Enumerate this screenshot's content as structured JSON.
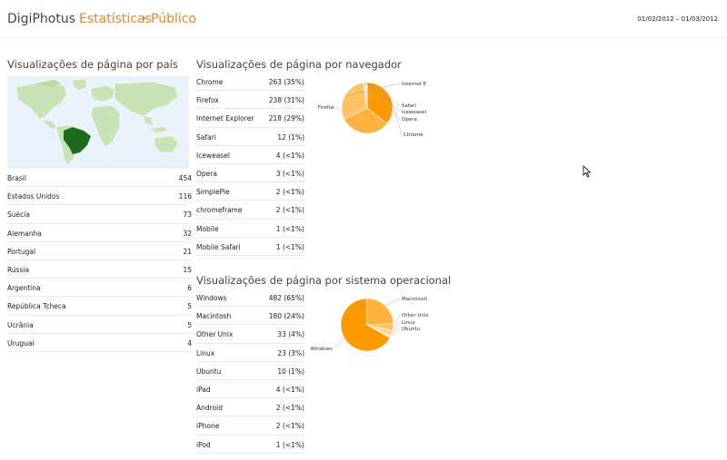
{
  "header": {
    "app_name": "DigiPhotus",
    "separator_dot": "·",
    "crumbs": [
      "Estatísticas",
      "Público"
    ],
    "crumb_separator": "›",
    "date_range": "01/02/2012 – 01/03/2012"
  },
  "country": {
    "title": "Visualizações de página por país",
    "rows": [
      {
        "name": "Brasil",
        "value": "454"
      },
      {
        "name": "Estados Unidos",
        "value": "116"
      },
      {
        "name": "Suécia",
        "value": "73"
      },
      {
        "name": "Alemanha",
        "value": "32"
      },
      {
        "name": "Portugal",
        "value": "21"
      },
      {
        "name": "Rússia",
        "value": "15"
      },
      {
        "name": "Argentina",
        "value": "6"
      },
      {
        "name": "República Tcheca",
        "value": "5"
      },
      {
        "name": "Ucrânia",
        "value": "5"
      },
      {
        "name": "Uruguai",
        "value": "4"
      }
    ]
  },
  "browser": {
    "title": "Visualizações de página por navegador",
    "rows": [
      {
        "name": "Chrome",
        "value": "263 (35%)"
      },
      {
        "name": "Firefox",
        "value": "238 (31%)"
      },
      {
        "name": "Internet Explorer",
        "value": "218 (29%)"
      },
      {
        "name": "Safari",
        "value": "12 (1%)"
      },
      {
        "name": "Iceweasel",
        "value": "4 (<1%)"
      },
      {
        "name": "Opera",
        "value": "3 (<1%)"
      },
      {
        "name": "SimplePie",
        "value": "2 (<1%)"
      },
      {
        "name": "chromeframe",
        "value": "2 (<1%)"
      },
      {
        "name": "Mobile",
        "value": "1 (<1%)"
      },
      {
        "name": "Mobile Safari",
        "value": "1 (<1%)"
      }
    ]
  },
  "os": {
    "title": "Visualizações de página por sistema operacional",
    "rows": [
      {
        "name": "Windows",
        "value": "482 (65%)"
      },
      {
        "name": "Macintosh",
        "value": "180 (24%)"
      },
      {
        "name": "Other Unix",
        "value": "33 (4%)"
      },
      {
        "name": "Linux",
        "value": "23 (3%)"
      },
      {
        "name": "Ubuntu",
        "value": "10 (1%)"
      },
      {
        "name": "iPad",
        "value": "4 (<1%)"
      },
      {
        "name": "Android",
        "value": "2 (<1%)"
      },
      {
        "name": "iPhone",
        "value": "2 (<1%)"
      },
      {
        "name": "iPod",
        "value": "1 (<1%)"
      }
    ]
  },
  "chart_data": [
    {
      "type": "pie",
      "labels": [
        "Chrome",
        "Firefox",
        "Internet E",
        "Safari",
        "Iceweasel",
        "Opera"
      ],
      "values": [
        263,
        238,
        218,
        12,
        4,
        3
      ],
      "colors": [
        "#ff9900",
        "#ffb33d",
        "#ffc266",
        "#ffd699",
        "#ffe0b3",
        "#ffeacc"
      ]
    },
    {
      "type": "pie",
      "labels": [
        "Windows",
        "Macintosh",
        "Other Unix",
        "Linux",
        "Ubuntu"
      ],
      "values": [
        482,
        180,
        33,
        23,
        10
      ],
      "colors": [
        "#ff9900",
        "#ffb33d",
        "#ffc266",
        "#ffd699",
        "#ffe0b3"
      ]
    }
  ],
  "colors": {
    "accent": "#e8852a",
    "map_brazil": "#1d6b1d",
    "map_land": "#c8e3b5",
    "map_water": "#eaf3fb"
  }
}
